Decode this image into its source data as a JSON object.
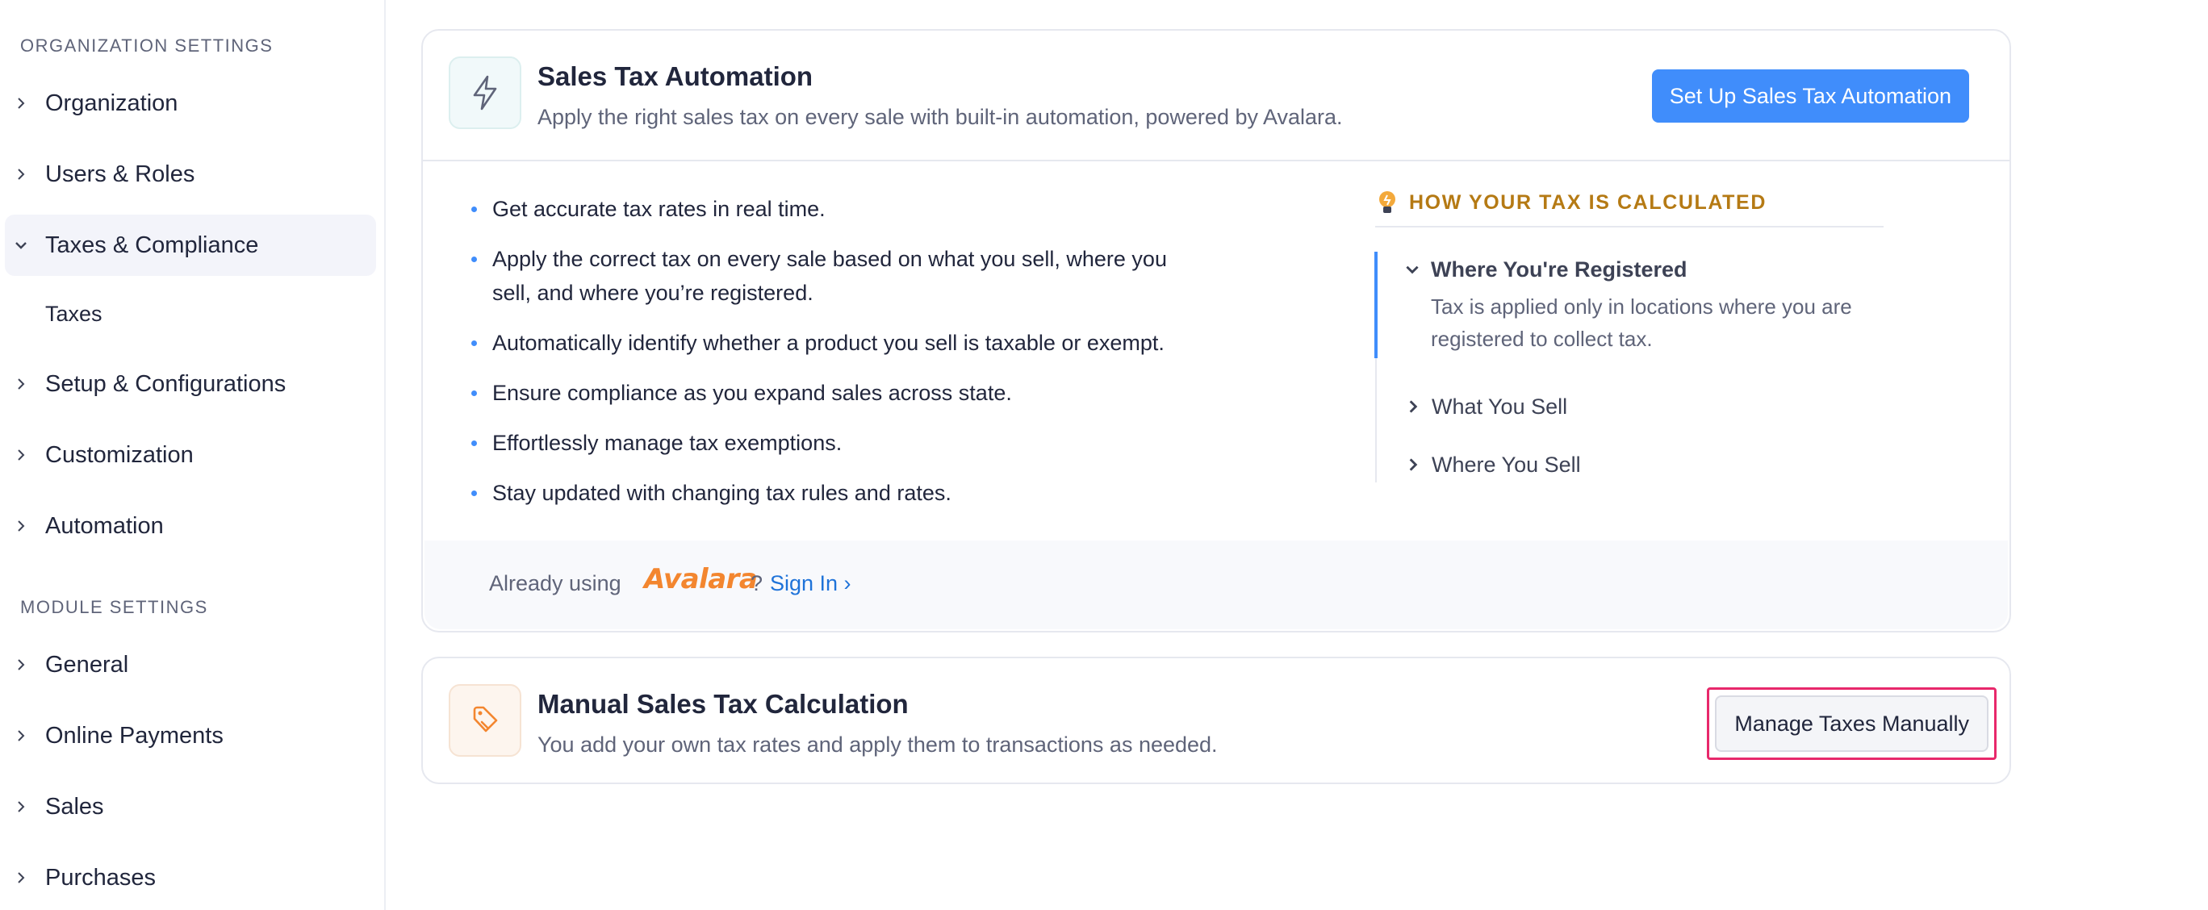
{
  "sidebar": {
    "org_title": "ORGANIZATION SETTINGS",
    "org_items": [
      {
        "label": "Organization"
      },
      {
        "label": "Users & Roles"
      },
      {
        "label": "Taxes & Compliance"
      },
      {
        "label": "Setup & Configurations"
      },
      {
        "label": "Customization"
      },
      {
        "label": "Automation"
      }
    ],
    "taxes_sub": "Taxes",
    "module_title": "MODULE SETTINGS",
    "module_items": [
      {
        "label": "General"
      },
      {
        "label": "Online Payments"
      },
      {
        "label": "Sales"
      },
      {
        "label": "Purchases"
      }
    ]
  },
  "automation": {
    "title": "Sales Tax Automation",
    "description": "Apply the right sales tax on every sale with built-in automation, powered by Avalara.",
    "button": "Set Up Sales Tax Automation",
    "benefits": [
      "Get accurate tax rates in real time.",
      "Apply the correct tax on every sale based on what you sell, where you sell, and where you’re registered.",
      "Automatically identify whether a product you sell is taxable or exempt.",
      "Ensure compliance as you expand sales across state.",
      "Effortlessly manage tax exemptions.",
      "Stay updated with changing tax rules and rates."
    ],
    "how": {
      "heading": "HOW YOUR TAX IS CALCULATED",
      "items": [
        {
          "title": "Where You're Registered",
          "body": "Tax is applied only in locations where you are registered to collect tax."
        },
        {
          "title": "What You Sell"
        },
        {
          "title": "Where You Sell"
        }
      ]
    },
    "footer": {
      "prefix": "Already using",
      "brand": "Avalara",
      "qmark": "?",
      "signin": "Sign In ›"
    }
  },
  "manual": {
    "title": "Manual Sales Tax Calculation",
    "description": "You add your own tax rates and apply them to transactions as needed.",
    "button": "Manage Taxes Manually"
  },
  "colors": {
    "accent": "#408dfb",
    "highlight": "#e8286b",
    "how_heading": "#b57a14",
    "avalara": "#f3862f"
  },
  "icons": {
    "automation": "lightning-icon",
    "manual": "tag-icon",
    "how": "lightbulb-icon"
  }
}
